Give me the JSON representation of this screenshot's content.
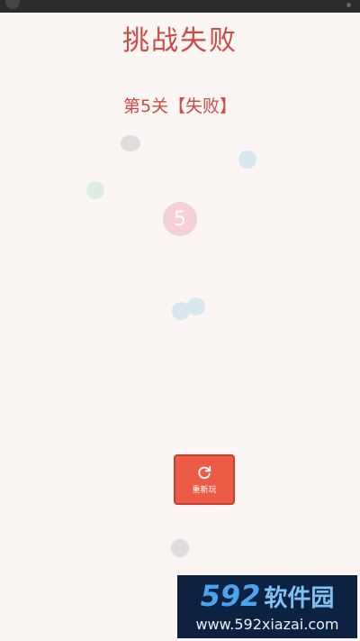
{
  "title": "挑战失败",
  "level_result": "第5关【失败】",
  "level_bubble": "5",
  "replay_button": {
    "label": "重新玩"
  },
  "watermark": {
    "logo_number": "592",
    "logo_text": "软件园",
    "url": "www.592xiazai.com"
  },
  "colors": {
    "accent": "#cf4a45",
    "button": "#ec5b45",
    "background": "#fbf6f3"
  }
}
